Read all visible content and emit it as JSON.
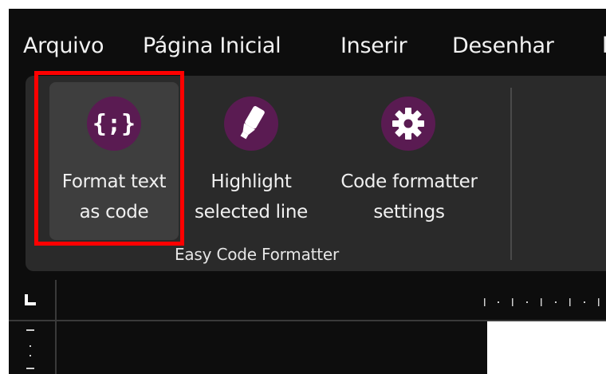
{
  "menu": {
    "items": [
      {
        "label": "Arquivo"
      },
      {
        "label": "Página Inicial"
      },
      {
        "label": "Inserir"
      },
      {
        "label": "Desenhar"
      }
    ]
  },
  "ribbon": {
    "group_label": "Easy Code Formatter",
    "buttons": [
      {
        "line1": "Format text",
        "line2": "as code",
        "icon": "code-braces-icon",
        "selected": true
      },
      {
        "line1": "Highlight",
        "line2": "selected line",
        "icon": "highlighter-icon",
        "selected": false
      },
      {
        "line1": "Code formatter",
        "line2": "settings",
        "icon": "gear-icon",
        "selected": false
      }
    ]
  },
  "colors": {
    "icon_background": "#5a1b52",
    "highlight_outline": "#ff0000",
    "ribbon_background": "#2a2a2a",
    "app_background": "#0d0d0d"
  }
}
